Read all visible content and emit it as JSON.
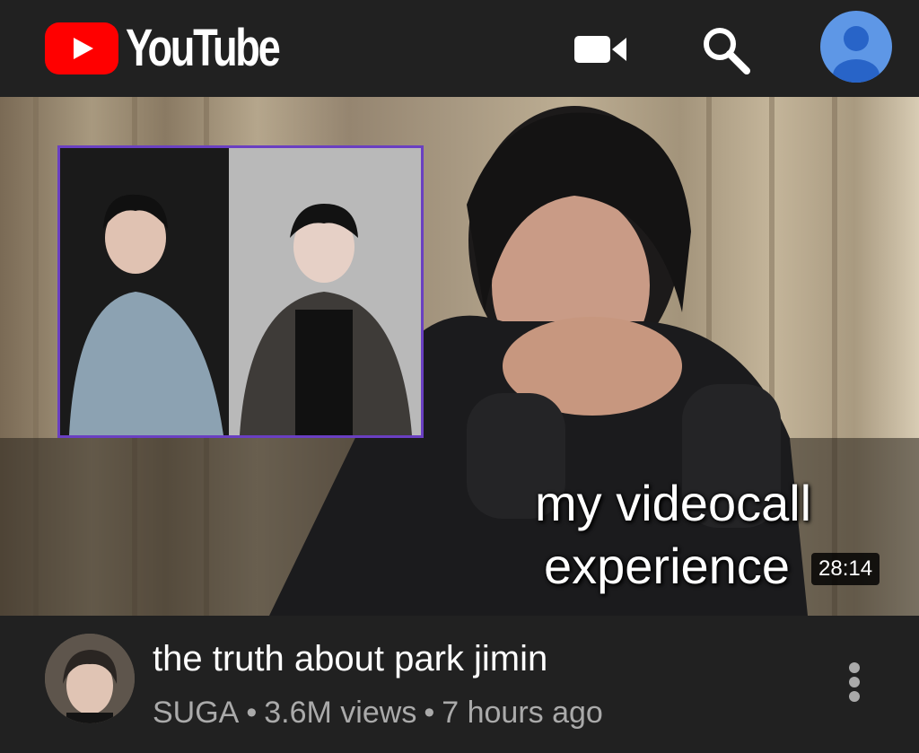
{
  "header": {
    "logo_text": "YouTube",
    "icons": [
      "video-camera-icon",
      "search-icon",
      "account-avatar-icon"
    ]
  },
  "video": {
    "overlay_line1": "my videocall",
    "overlay_line2": "experience",
    "duration": "28:14",
    "title": "the truth about park jimin",
    "channel": "SUGA",
    "views": "3.6M views",
    "age": "7 hours ago",
    "separator": "•"
  },
  "colors": {
    "background": "#212121",
    "logo_red": "#ff0000",
    "avatar_blue": "#5e97e6",
    "meta_gray": "#aaaaaa",
    "inset_border": "#6a3fc2"
  }
}
